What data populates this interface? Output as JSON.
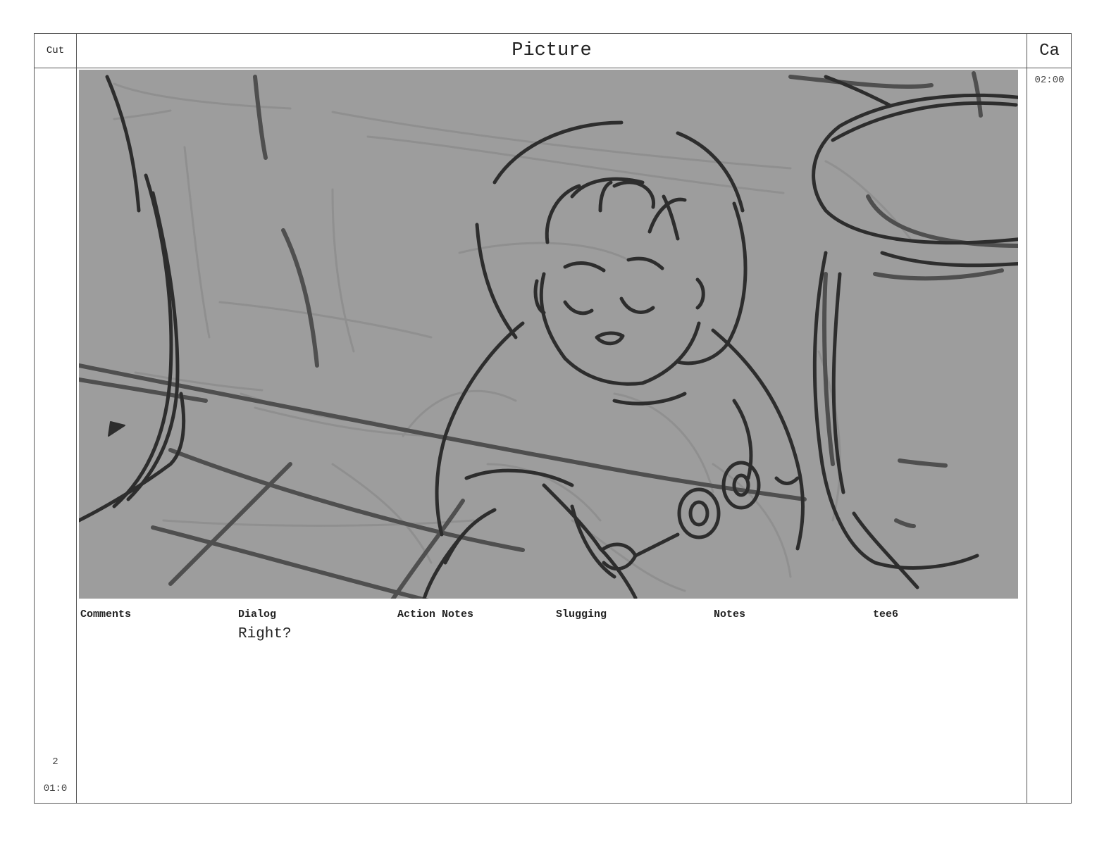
{
  "header": {
    "cut": "Cut",
    "picture": "Picture",
    "camera": "Ca"
  },
  "camera_time": "02:00",
  "fields": {
    "comments": "Comments",
    "dialog": "Dialog",
    "action_notes": "Action Notes",
    "slugging": "Slugging",
    "notes": "Notes",
    "tee6": "tee6"
  },
  "dialog_text": "Right?",
  "panel": {
    "number": "2",
    "duration": "01:0"
  },
  "frame": {
    "background": "#9d9d9d",
    "line_dark": "#2d2d2d",
    "line_mid": "#555555",
    "line_light": "#8a8a8a"
  }
}
